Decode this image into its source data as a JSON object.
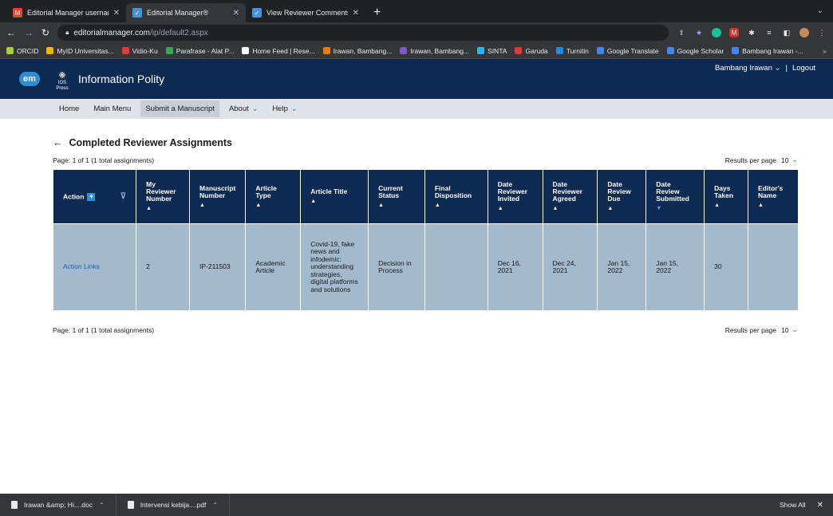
{
  "browser": {
    "tabs": [
      {
        "title": "Editorial Manager username an",
        "fav_color": "#ea4335",
        "fav_glyph": "M",
        "active": false
      },
      {
        "title": "Editorial Manager®",
        "fav_color": "#4a90d9",
        "fav_glyph": "✓",
        "active": true
      },
      {
        "title": "View Reviewer Comments",
        "fav_color": "#4a90d9",
        "fav_glyph": "✓",
        "active": false
      }
    ],
    "new_tab": "+",
    "url_host": "editorialmanager.com",
    "url_path": "/ip/default2.aspx",
    "bookmarks": [
      {
        "label": "ORCID",
        "color": "#a6ce39"
      },
      {
        "label": "MyID Universitas...",
        "color": "#f4b400"
      },
      {
        "label": "Vidio-Ku",
        "color": "#e53935"
      },
      {
        "label": "Parafrase - Alat P...",
        "color": "#34a853"
      },
      {
        "label": "Home Feed | Rese...",
        "color": "#ffffff"
      },
      {
        "label": "Irawan, Bambang...",
        "color": "#f57c00"
      },
      {
        "label": "Irawan, Bambang...",
        "color": "#7e57c2"
      },
      {
        "label": "SINTA",
        "color": "#29b6f6"
      },
      {
        "label": "Garuda",
        "color": "#e53935"
      },
      {
        "label": "Turnitin",
        "color": "#1e88e5"
      },
      {
        "label": "Google Translate",
        "color": "#4285f4"
      },
      {
        "label": "Google Scholar",
        "color": "#4285f4"
      },
      {
        "label": "Bambang Irawan -...",
        "color": "#4285f4"
      }
    ],
    "bookmarks_more": "»"
  },
  "header": {
    "em_logo": "em",
    "ios_logo": "IOS Press",
    "journal_title": "Information Polity",
    "user_name": "Bambang Irawan",
    "separator": "|",
    "logout": "Logout"
  },
  "menu": [
    {
      "label": "Home",
      "dropdown": false,
      "active": false
    },
    {
      "label": "Main Menu",
      "dropdown": false,
      "active": false
    },
    {
      "label": "Submit a Manuscript",
      "dropdown": false,
      "active": true
    },
    {
      "label": "About",
      "dropdown": true,
      "active": false
    },
    {
      "label": "Help",
      "dropdown": true,
      "active": false
    }
  ],
  "page": {
    "back_arrow": "←",
    "title": "Completed Reviewer Assignments",
    "page_info": "Page: 1 of 1 (1 total assignments)",
    "results_per_page_label": "Results per page",
    "results_per_page_value": "10"
  },
  "table": {
    "action_header": "Action",
    "columns": [
      {
        "label": "My Reviewer Number",
        "sort": "▲",
        "active": false
      },
      {
        "label": "Manuscript Number",
        "sort": "▲",
        "active": false
      },
      {
        "label": "Article Type",
        "sort": "▲",
        "active": false
      },
      {
        "label": "Article Title",
        "sort": "▲",
        "active": false
      },
      {
        "label": "Current Status",
        "sort": "▲",
        "active": false
      },
      {
        "label": "Final Disposition",
        "sort": "▲",
        "active": false
      },
      {
        "label": "Date Reviewer Invited",
        "sort": "▲",
        "active": false
      },
      {
        "label": "Date Reviewer Agreed",
        "sort": "▲",
        "active": false
      },
      {
        "label": "Date Review Due",
        "sort": "▲",
        "active": false
      },
      {
        "label": "Date Review Submitted",
        "sort": "▼",
        "active": true
      },
      {
        "label": "Days Taken",
        "sort": "▲",
        "active": false
      },
      {
        "label": "Editor's Name",
        "sort": "▲",
        "active": false
      }
    ],
    "rows": [
      {
        "action": "Action Links",
        "cells": [
          "2",
          "IP-211503",
          "Academic Article",
          "Covid-19, fake news and infodemic: understanding strategies, digital platforms and solutions",
          "Decision in Process",
          "",
          "Dec 16, 2021",
          "Dec 24, 2021",
          "Jan 15, 2022",
          "Jan 15, 2022",
          "30",
          ""
        ]
      }
    ]
  },
  "downloads": {
    "items": [
      "Irawan &amp; Hi....doc",
      "Intervensi kebija....pdf"
    ],
    "show_all": "Show All",
    "close": "✕"
  }
}
